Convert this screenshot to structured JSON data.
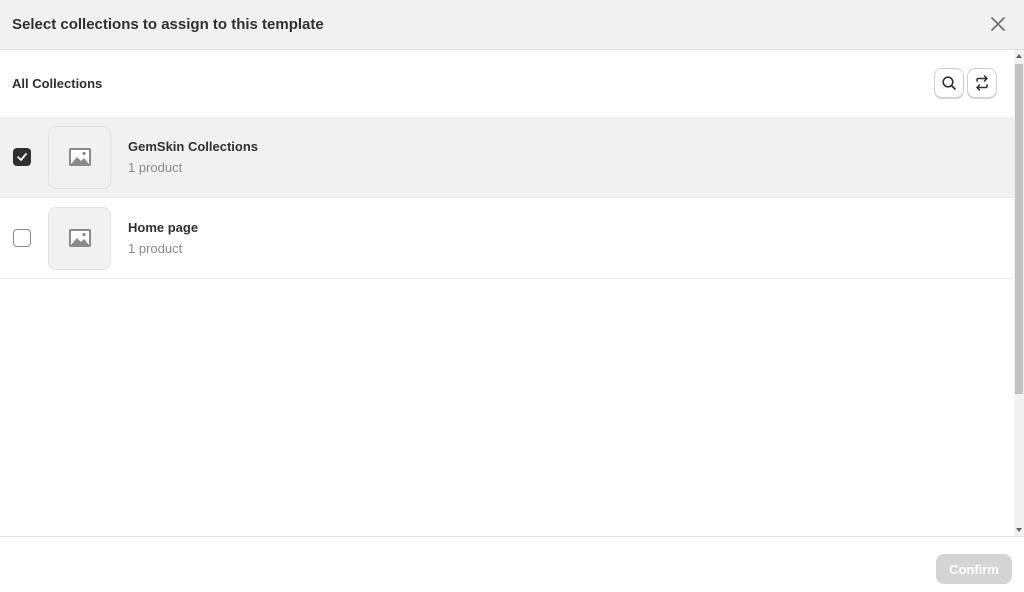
{
  "modal": {
    "title": "Select collections to assign to this template",
    "close_icon": "close-icon"
  },
  "list": {
    "title": "All Collections",
    "search_icon": "search-icon",
    "swap_icon": "arrows-swap-icon",
    "items": [
      {
        "name": "GemSkin Collections",
        "subtitle": "1 product",
        "checked": true,
        "thumb_icon": "image-placeholder-icon"
      },
      {
        "name": "Home page",
        "subtitle": "1 product",
        "checked": false,
        "thumb_icon": "image-placeholder-icon"
      }
    ]
  },
  "footer": {
    "confirm_label": "Confirm",
    "confirm_disabled": true
  },
  "colors": {
    "header_bg": "#f1f1f1",
    "selected_row_bg": "#f1f1f1",
    "checkbox_checked": "#303030",
    "confirm_disabled_bg": "#d4d4d4"
  }
}
